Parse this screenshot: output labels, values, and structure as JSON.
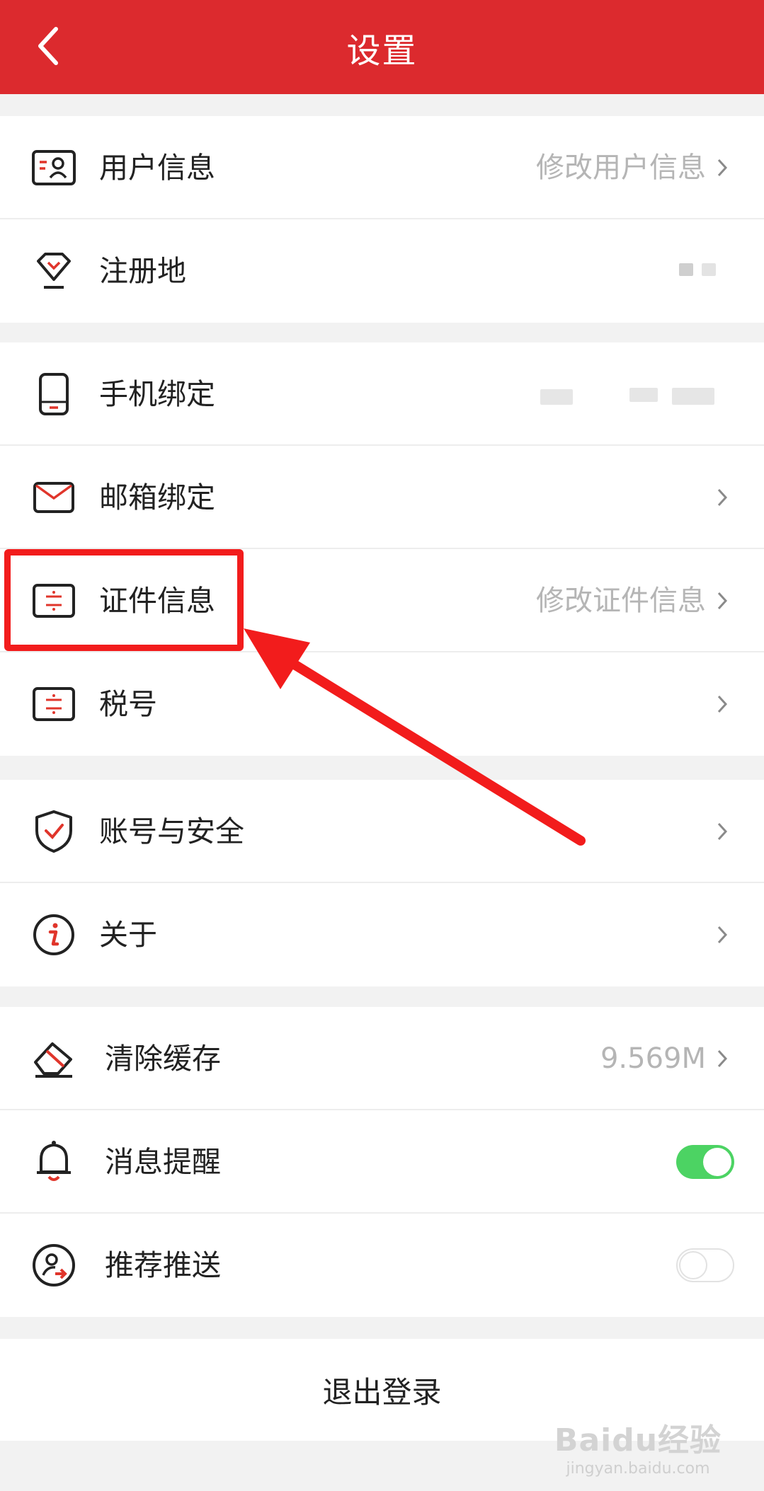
{
  "header": {
    "title": "设置"
  },
  "groups": [
    {
      "rows": [
        {
          "label": "用户信息",
          "value": "修改用户信息",
          "icon": "user-card-icon"
        },
        {
          "label": "注册地",
          "value": "",
          "icon": "location-pin-icon"
        }
      ]
    },
    {
      "rows": [
        {
          "label": "手机绑定",
          "value": "",
          "icon": "phone-icon"
        },
        {
          "label": "邮箱绑定",
          "value": "",
          "icon": "mail-icon"
        },
        {
          "label": "证件信息",
          "value": "修改证件信息",
          "icon": "id-card-icon"
        },
        {
          "label": "税号",
          "value": "",
          "icon": "tax-card-icon"
        }
      ]
    },
    {
      "rows": [
        {
          "label": "账号与安全",
          "value": "",
          "icon": "shield-check-icon"
        },
        {
          "label": "关于",
          "value": "",
          "icon": "info-icon"
        }
      ]
    },
    {
      "rows": [
        {
          "label": "清除缓存",
          "value": "9.569M",
          "icon": "eraser-icon"
        },
        {
          "label": "消息提醒",
          "toggle": true,
          "icon": "bell-icon"
        },
        {
          "label": "推荐推送",
          "toggle": false,
          "icon": "user-push-icon"
        }
      ]
    }
  ],
  "logout": {
    "label": "退出登录"
  },
  "watermark": {
    "brand": "Baidu经验",
    "url": "jingyan.baidu.com"
  },
  "colors": {
    "header": "#dc2a2e",
    "accent": "#e0352b",
    "toggle_on": "#4cd363",
    "annotation": "#f21c1c"
  }
}
